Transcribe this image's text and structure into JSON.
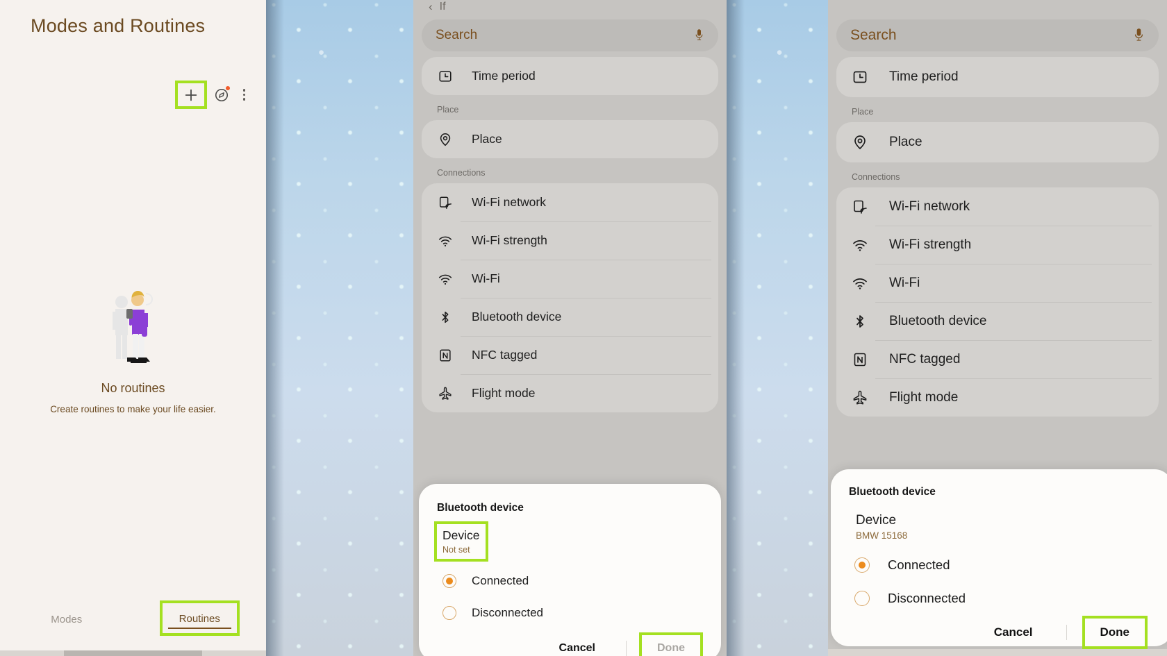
{
  "panel1": {
    "title": "Modes and Routines",
    "actions": {
      "add_label": "+",
      "discover_label": "discover",
      "more_label": "more options"
    },
    "empty": {
      "title": "No routines",
      "subtitle": "Create routines to make your life easier."
    },
    "tabs": [
      {
        "label": "Modes",
        "active": false
      },
      {
        "label": "Routines",
        "active": true
      }
    ],
    "colors": {
      "text": "#6b4a21",
      "bg": "#f6f2ee",
      "highlight": "#a4e021",
      "badge": "#f25c2b"
    }
  },
  "panel2": {
    "topbar": {
      "back": "‹",
      "title": "If"
    },
    "search": {
      "text": "Search",
      "mic": "mic-icon"
    },
    "items_top": [
      {
        "icon": "clock-icon",
        "label": "Time period"
      }
    ],
    "sections": [
      {
        "header": "Place",
        "items": [
          {
            "icon": "location-pin-icon",
            "label": "Place"
          }
        ]
      },
      {
        "header": "Connections",
        "items": [
          {
            "icon": "wifi-network-icon",
            "label": "Wi-Fi network"
          },
          {
            "icon": "wifi-strength-icon",
            "label": "Wi-Fi strength"
          },
          {
            "icon": "wifi-icon",
            "label": "Wi-Fi"
          },
          {
            "icon": "bluetooth-icon",
            "label": "Bluetooth device"
          },
          {
            "icon": "nfc-icon",
            "label": "NFC tagged"
          },
          {
            "icon": "flight-mode-icon",
            "label": "Flight mode"
          }
        ]
      }
    ],
    "dialog": {
      "title": "Bluetooth device",
      "device_label": "Device",
      "device_value": "Not set",
      "options": [
        {
          "label": "Connected",
          "selected": true
        },
        {
          "label": "Disconnected",
          "selected": false
        }
      ],
      "cancel": "Cancel",
      "done": "Done",
      "done_enabled": false
    }
  },
  "panel4": {
    "search": {
      "text": "Search",
      "mic": "mic-icon"
    },
    "items_top": [
      {
        "icon": "clock-icon",
        "label": "Time period"
      }
    ],
    "sections": [
      {
        "header": "Place",
        "items": [
          {
            "icon": "location-pin-icon",
            "label": "Place"
          }
        ]
      },
      {
        "header": "Connections",
        "items": [
          {
            "icon": "wifi-network-icon",
            "label": "Wi-Fi network"
          },
          {
            "icon": "wifi-strength-icon",
            "label": "Wi-Fi strength"
          },
          {
            "icon": "wifi-icon",
            "label": "Wi-Fi"
          },
          {
            "icon": "bluetooth-icon",
            "label": "Bluetooth device"
          },
          {
            "icon": "nfc-icon",
            "label": "NFC tagged"
          },
          {
            "icon": "flight-mode-icon",
            "label": "Flight mode"
          }
        ]
      }
    ],
    "dialog": {
      "title": "Bluetooth device",
      "device_label": "Device",
      "device_value": "BMW 15168",
      "options": [
        {
          "label": "Connected",
          "selected": true
        },
        {
          "label": "Disconnected",
          "selected": false
        }
      ],
      "cancel": "Cancel",
      "done": "Done",
      "done_enabled": true
    }
  }
}
